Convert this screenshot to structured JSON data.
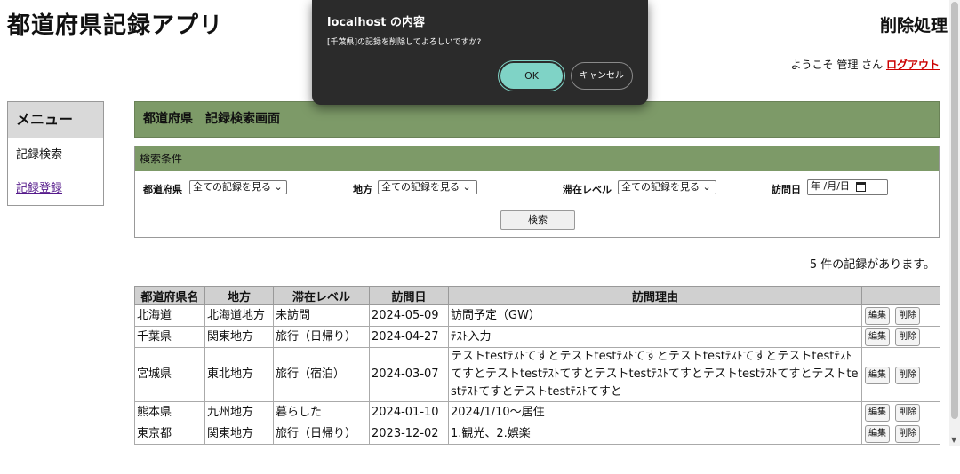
{
  "header": {
    "app_title": "都道府県記録アプリ",
    "page_heading": "削除処理",
    "welcome_prefix": "ようこそ 管理 さん",
    "logout_label": "ログアウト"
  },
  "menu": {
    "title": "メニュー",
    "items": [
      {
        "label": "記録検索"
      },
      {
        "label": "記録登録"
      }
    ]
  },
  "screen_title": "都道府県　記録検索画面",
  "search": {
    "section_title": "検索条件",
    "prefecture_label": "都道府県",
    "prefecture_value": "全ての記録を見る",
    "region_label": "地方",
    "region_value": "全ての記録を見る",
    "stay_label": "滞在レベル",
    "stay_value": "全ての記録を見る",
    "visit_date_label": "訪問日",
    "visit_date_placeholder": "年 /月/日",
    "button_label": "検索"
  },
  "record_count_text": "5 件の記録があります。",
  "table": {
    "headers": [
      "都道府県名",
      "地方",
      "滞在レベル",
      "訪問日",
      "訪問理由",
      ""
    ],
    "edit_label": "編集",
    "delete_label": "削除",
    "rows": [
      {
        "prefecture": "北海道",
        "region": "北海道地方",
        "stay": "未訪問",
        "date": "2024-05-09",
        "reason": "訪問予定（GW）"
      },
      {
        "prefecture": "千葉県",
        "region": "関東地方",
        "stay": "旅行（日帰り）",
        "date": "2024-04-27",
        "reason": "ﾃｽﾄ入力"
      },
      {
        "prefecture": "宮城県",
        "region": "東北地方",
        "stay": "旅行（宿泊）",
        "date": "2024-03-07",
        "reason": "テストtestﾃｽﾄてすとテストtestﾃｽﾄてすとテストtestﾃｽﾄてすとテストtestﾃｽﾄてすとテストtestﾃｽﾄてすとテストtestﾃｽﾄてすとテストtestﾃｽﾄてすとテストtestﾃｽﾄてすとテストtestﾃｽﾄてすと"
      },
      {
        "prefecture": "熊本県",
        "region": "九州地方",
        "stay": "暮らした",
        "date": "2024-01-10",
        "reason": "2024/1/10～居住"
      },
      {
        "prefecture": "東京都",
        "region": "関東地方",
        "stay": "旅行（日帰り）",
        "date": "2023-12-02",
        "reason": "1.観光、2.娯楽"
      }
    ]
  },
  "dialog": {
    "title": "localhost の内容",
    "message": "[千葉県]の記録を削除してよろしいですか?",
    "ok_label": "OK",
    "cancel_label": "キャンセル"
  },
  "colors": {
    "header_green": "#7d9a68",
    "dialog_bg": "#2b2b2b",
    "ok_button": "#7fd3c6",
    "logout_link": "#cc0000"
  },
  "icons": {
    "calendar": "calendar-icon",
    "dropdown": "chevron-down-icon"
  }
}
